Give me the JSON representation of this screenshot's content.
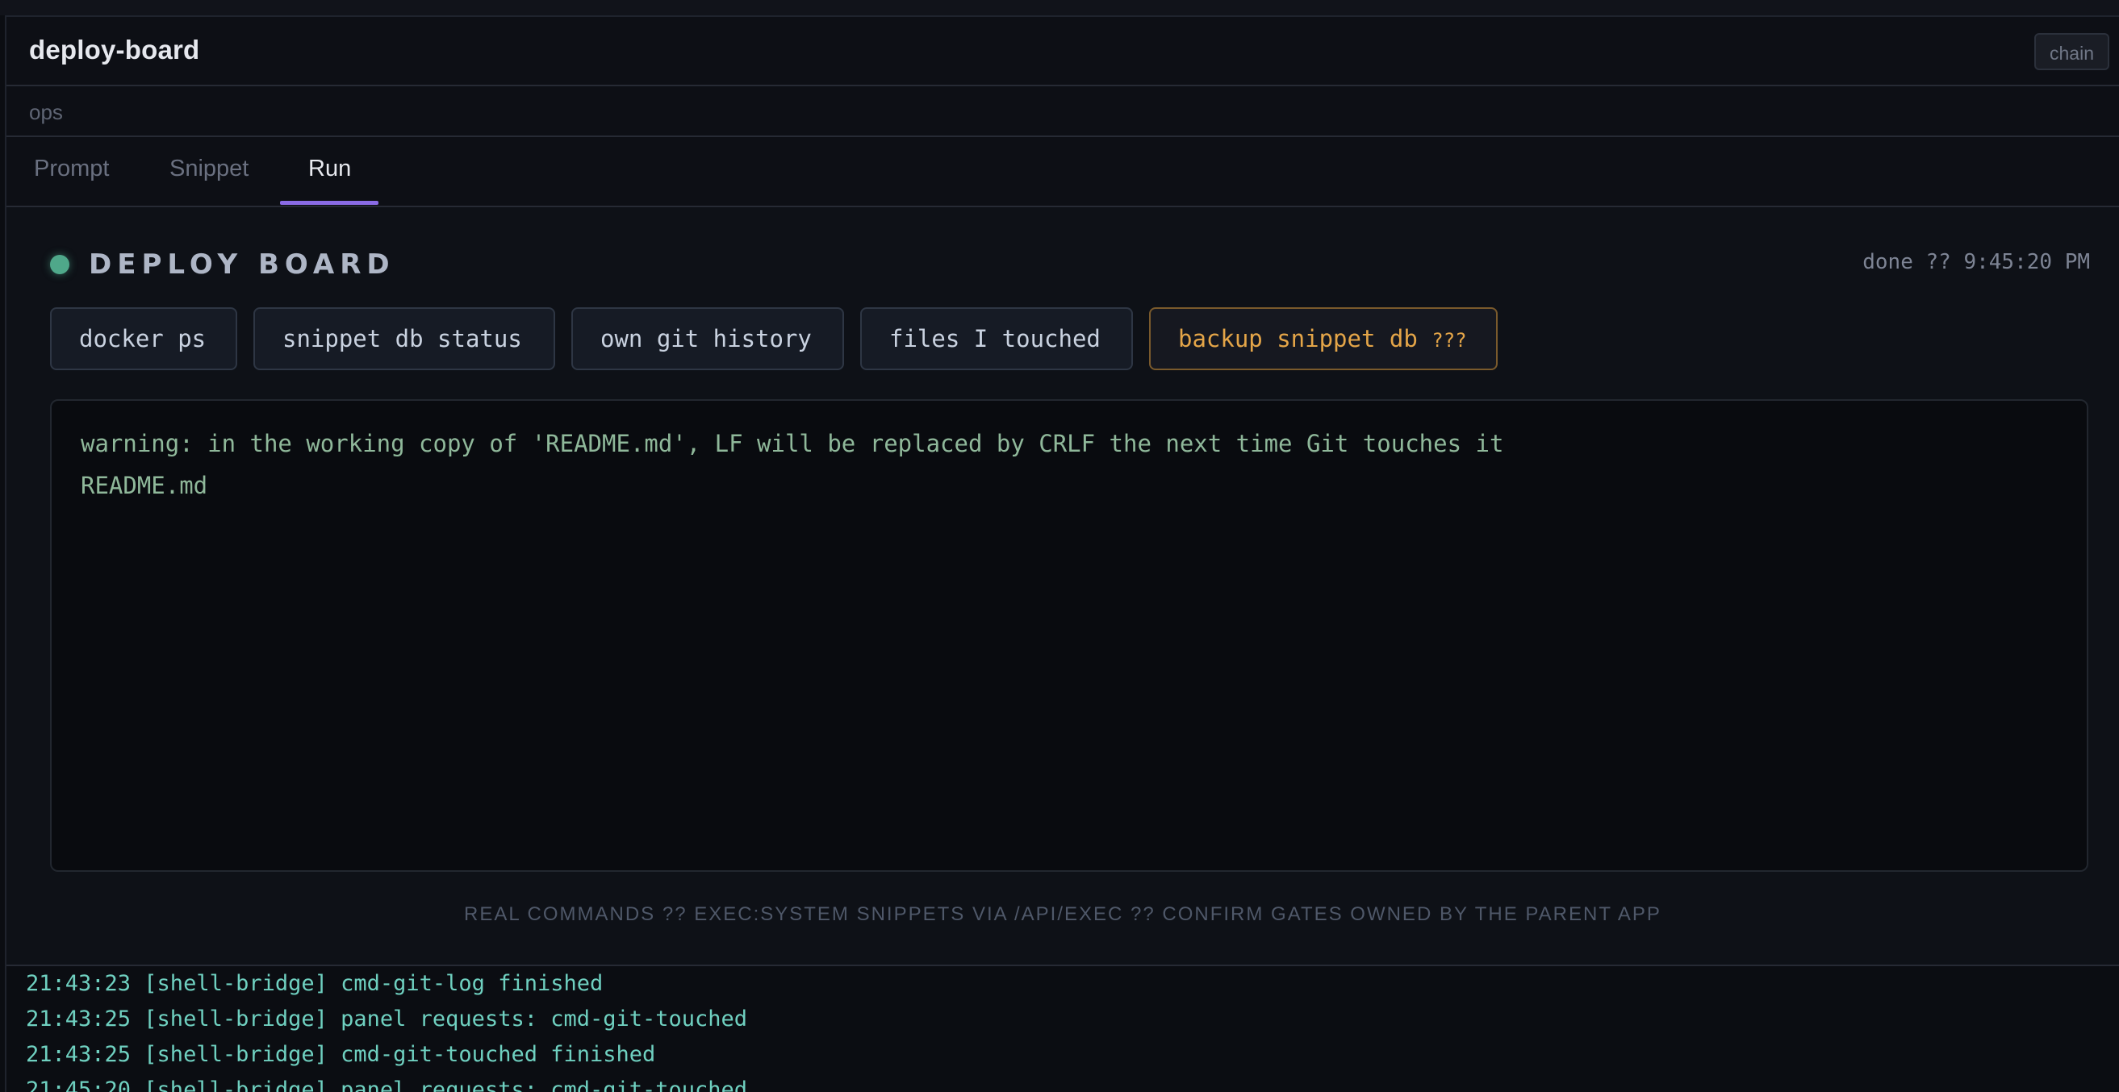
{
  "header": {
    "title": "deploy-board",
    "chain_label": "chain"
  },
  "context": {
    "label": "ops"
  },
  "tabs": [
    {
      "label": "Prompt",
      "active": false
    },
    {
      "label": "Snippet",
      "active": false
    },
    {
      "label": "Run",
      "active": true
    }
  ],
  "board": {
    "title": "DEPLOY BOARD",
    "status": "done ?? 9:45:20 PM",
    "status_color": "#4fa88a"
  },
  "actions": [
    {
      "label": "docker ps"
    },
    {
      "label": "snippet db status"
    },
    {
      "label": "own git history"
    },
    {
      "label": "files I touched"
    },
    {
      "label": "backup snippet db",
      "suffix": "???",
      "warning": true
    }
  ],
  "output": {
    "lines": [
      "warning: in the working copy of 'README.md', LF will be replaced by CRLF the next time Git touches it",
      "README.md"
    ]
  },
  "footnote": "REAL COMMANDS ?? EXEC:SYSTEM SNIPPETS VIA /API/EXEC ?? CONFIRM GATES OWNED BY THE PARENT APP",
  "log": {
    "lines": [
      "21:43:23 [shell-bridge] cmd-git-log finished",
      "21:43:25 [shell-bridge] panel requests: cmd-git-touched",
      "21:43:25 [shell-bridge] cmd-git-touched finished",
      "21:45:20 [shell-bridge] panel requests: cmd-git-touched"
    ]
  },
  "colors": {
    "accent": "#8a6be6",
    "warning": "#e4a548",
    "log_text": "#6fd0c0",
    "output_text": "#8fb89a"
  }
}
